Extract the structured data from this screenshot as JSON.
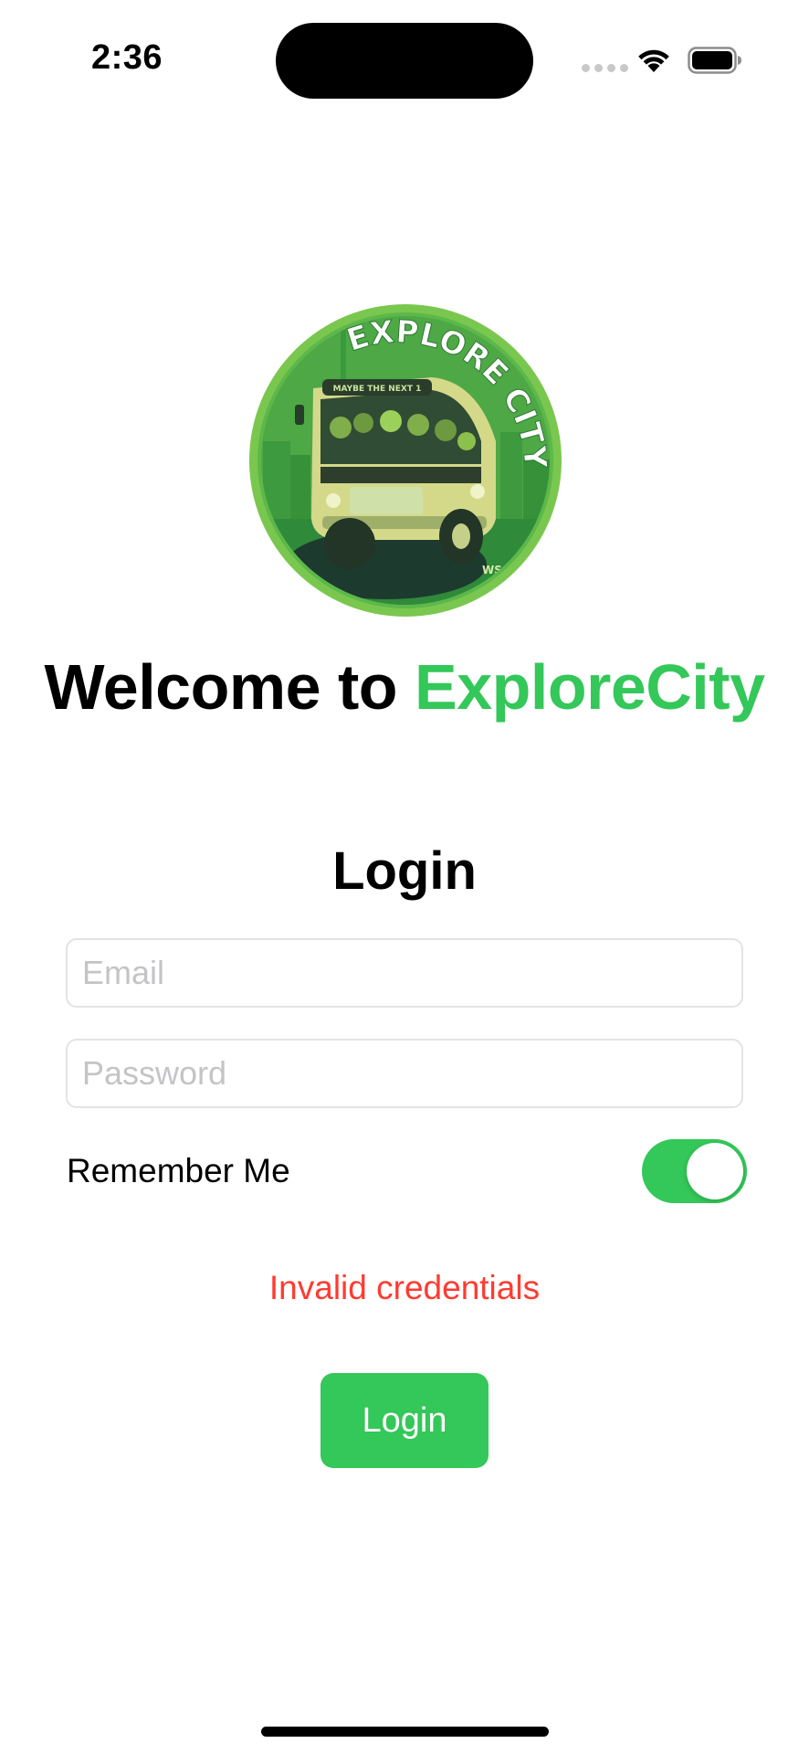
{
  "status_bar": {
    "time": "2:36"
  },
  "logo": {
    "text": "EXPLORE CITY",
    "sign_text": "MAYBE THE NEXT 1",
    "signature": "WS"
  },
  "welcome": {
    "prefix": "Welcome to ",
    "brand": "ExploreCity"
  },
  "login_form": {
    "title": "Login",
    "email_placeholder": "Email",
    "email_value": "",
    "password_placeholder": "Password",
    "password_value": "",
    "remember_label": "Remember Me",
    "remember_on": true,
    "error_message": "Invalid credentials",
    "submit_label": "Login"
  },
  "icons": [
    "wifi-icon",
    "battery-icon",
    "cellular-icon"
  ],
  "colors": {
    "accent": "#34c759",
    "error": "#ff3b30",
    "field_border": "#e3e3e6",
    "placeholder": "#c4c4c7"
  }
}
